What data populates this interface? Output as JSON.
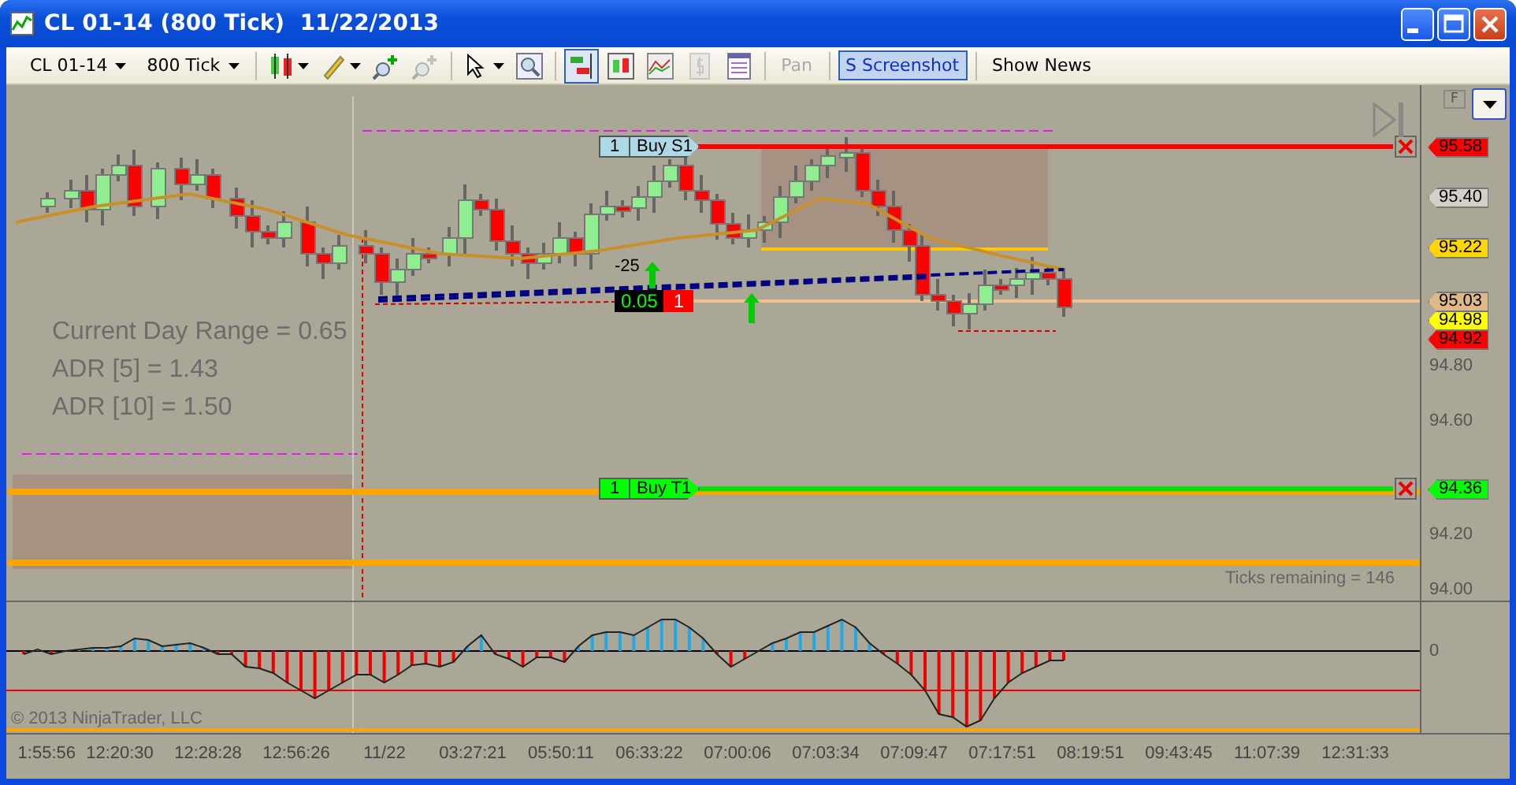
{
  "window": {
    "title": "CL 01-14 (800 Tick)  11/22/2013"
  },
  "toolbar": {
    "instrument": "CL 01-14",
    "interval": "800 Tick",
    "icon_buttons": [
      {
        "pressed": false,
        "disabled": false
      },
      {
        "pressed": false,
        "disabled": false
      },
      {
        "pressed": false,
        "disabled": false
      },
      {
        "pressed": false,
        "disabled": true
      },
      {
        "pressed": false,
        "disabled": false
      },
      {
        "pressed": false,
        "disabled": false
      },
      {
        "pressed": true,
        "disabled": false
      },
      {
        "pressed": false,
        "disabled": false
      },
      {
        "pressed": false,
        "disabled": false
      },
      {
        "pressed": false,
        "disabled": true
      },
      {
        "pressed": false,
        "disabled": false
      }
    ],
    "text_buttons": [
      {
        "label": "Pan",
        "disabled": true,
        "selected": false
      },
      {
        "label": "S Screenshot",
        "disabled": false,
        "selected": true
      },
      {
        "label": "Show News",
        "disabled": false,
        "selected": false
      }
    ]
  },
  "indicators": [
    "Current Day Range = 0.65",
    "ADR [5] = 1.43",
    "ADR [10] = 1.50"
  ],
  "orders": [
    {
      "kind": "stop",
      "qty": "1",
      "label": "Buy S1",
      "price": "95.58"
    },
    {
      "kind": "target",
      "qty": "1",
      "label": "Buy T1",
      "price": "94.36"
    }
  ],
  "signal": {
    "label": "-25"
  },
  "position": {
    "pnl": "0.05",
    "qty": "1"
  },
  "ticks_remaining": "Ticks remaining = 146",
  "price_axis": {
    "ticks": [
      "94.80",
      "94.60",
      "94.20",
      "94.00"
    ],
    "markers": [
      {
        "price": "95.40",
        "color": "#d4d0c8"
      },
      {
        "price": "95.22",
        "color": "#ffd700"
      },
      {
        "price": "95.03",
        "color": "#deb887"
      },
      {
        "price": "94.98",
        "color": "#ffff00"
      },
      {
        "price": "94.92",
        "color": "#ff0000"
      }
    ]
  },
  "panel_button": {
    "label": "F"
  },
  "oscillator": {
    "zero_label": "0"
  },
  "copyright": "© 2013 NinjaTrader, LLC",
  "time_axis": [
    "1:55:56",
    "12:20:30",
    "12:28:28",
    "12:56:26",
    "11/22",
    "03:27:21",
    "05:50:11",
    "06:33:22",
    "07:00:06",
    "07:03:34",
    "07:09:47",
    "07:17:51",
    "08:19:51",
    "09:43:45",
    "11:07:39",
    "12:31:33"
  ]
}
